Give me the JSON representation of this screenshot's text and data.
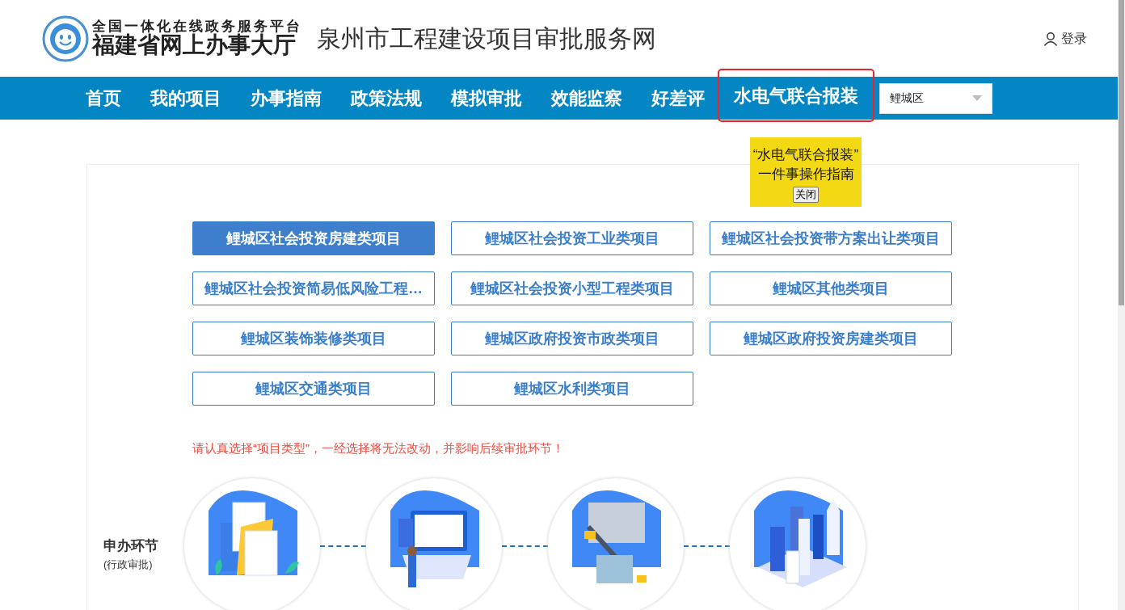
{
  "header": {
    "logo_line_1": "全国一体化在线政务服务平台",
    "logo_line_2": "福建省网上办事大厅",
    "site_title": "泉州市工程建设项目审批服务网",
    "login": "登录"
  },
  "nav": {
    "items": [
      {
        "label": "首页",
        "highlighted": false
      },
      {
        "label": "我的项目",
        "highlighted": false
      },
      {
        "label": "办事指南",
        "highlighted": false
      },
      {
        "label": "政策法规",
        "highlighted": false
      },
      {
        "label": "模拟审批",
        "highlighted": false
      },
      {
        "label": "效能监察",
        "highlighted": false
      },
      {
        "label": "好差评",
        "highlighted": false
      },
      {
        "label": "水电气联合报装",
        "highlighted": true
      }
    ],
    "district": {
      "value": "鲤城区"
    }
  },
  "popup": {
    "lines": [
      "“水电气联合报装”",
      "一件事操作指南"
    ],
    "close_button": "关闭"
  },
  "project_types": [
    {
      "label": "鲤城区社会投资房建类项目",
      "selected": true
    },
    {
      "label": "鲤城区社会投资工业类项目",
      "selected": false
    },
    {
      "label": "鲤城区社会投资带方案出让类项目",
      "selected": false
    },
    {
      "label": "鲤城区社会投资简易低风险工程…",
      "selected": false
    },
    {
      "label": "鲤城区社会投资小型工程类项目",
      "selected": false
    },
    {
      "label": "鲤城区其他类项目",
      "selected": false
    },
    {
      "label": "鲤城区装饰装修类项目",
      "selected": false
    },
    {
      "label": "鲤城区政府投资市政类项目",
      "selected": false
    },
    {
      "label": "鲤城区政府投资房建类项目",
      "selected": false
    },
    {
      "label": "鲤城区交通类项目",
      "selected": false
    },
    {
      "label": "鲤城区水利类项目",
      "selected": false
    }
  ],
  "notice": "请认真选择“项目类型”，一经选择将无法改动，并影响后续审批环节！",
  "process": {
    "label": "申办环节",
    "sublabel": "(行政审批)",
    "stages": [
      {
        "kind": "documents"
      },
      {
        "kind": "computer"
      },
      {
        "kind": "construction"
      },
      {
        "kind": "city"
      }
    ]
  }
}
